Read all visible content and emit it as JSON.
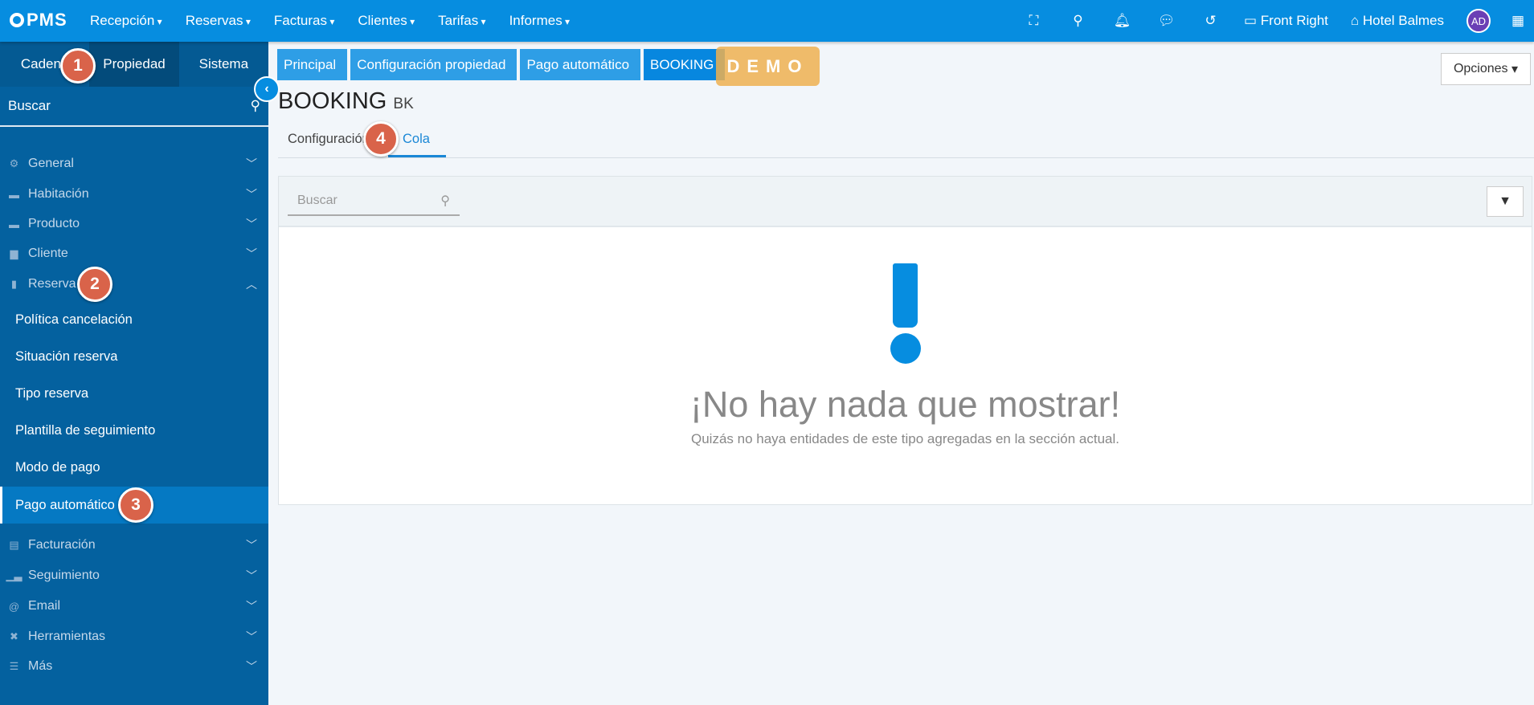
{
  "topbar": {
    "logo": "PMS",
    "nav": [
      "Recepción",
      "Reservas",
      "Facturas",
      "Clientes",
      "Tarifas",
      "Informes"
    ],
    "icons": [
      "fullscreen-icon",
      "search-icon",
      "bell-icon",
      "chat-icon",
      "history-icon"
    ],
    "front": "Front Right",
    "hotel": "Hotel Balmes",
    "avatar": "AD"
  },
  "sidebar": {
    "tabs": [
      "Cadena",
      "Propiedad",
      "Sistema"
    ],
    "active_tab": "Propiedad",
    "search": "Buscar",
    "menu": [
      {
        "label": "General",
        "icon": "cogs-icon"
      },
      {
        "label": "Habitación",
        "icon": "bed-icon"
      },
      {
        "label": "Producto",
        "icon": "box-icon"
      },
      {
        "label": "Cliente",
        "icon": "id-card-icon"
      },
      {
        "label": "Reserva",
        "icon": "file-icon"
      }
    ],
    "submenu": [
      "Política cancelación",
      "Situación reserva",
      "Tipo reserva",
      "Plantilla de seguimiento",
      "Modo de pago",
      "Pago automático"
    ],
    "active_sub": "Pago automático",
    "menu2": [
      {
        "label": "Facturación",
        "icon": "receipt-icon"
      },
      {
        "label": "Seguimiento",
        "icon": "chart-icon"
      },
      {
        "label": "Email",
        "icon": "at-icon"
      },
      {
        "label": "Herramientas",
        "icon": "tools-icon"
      },
      {
        "label": "Más",
        "icon": "sliders-icon"
      }
    ]
  },
  "breadcrumb": [
    "Principal",
    "Configuración propiedad",
    "Pago automático",
    "BOOKING"
  ],
  "demo": "DEMO",
  "options": "Opciones",
  "page": {
    "title": "BOOKING",
    "code": "BK"
  },
  "tabs": [
    "Configuración",
    "Cola"
  ],
  "active_tab": "Cola",
  "panel": {
    "search_placeholder": "Buscar",
    "empty_title": "¡No hay nada que mostrar!",
    "empty_sub": "Quizás no haya entidades de este tipo agregadas en la sección actual."
  },
  "badges": [
    "1",
    "2",
    "3",
    "4"
  ],
  "colors": {
    "topbar": "#068de0",
    "sidebar": "#04619f",
    "badge": "#d9634a",
    "accent": "#068de0"
  }
}
